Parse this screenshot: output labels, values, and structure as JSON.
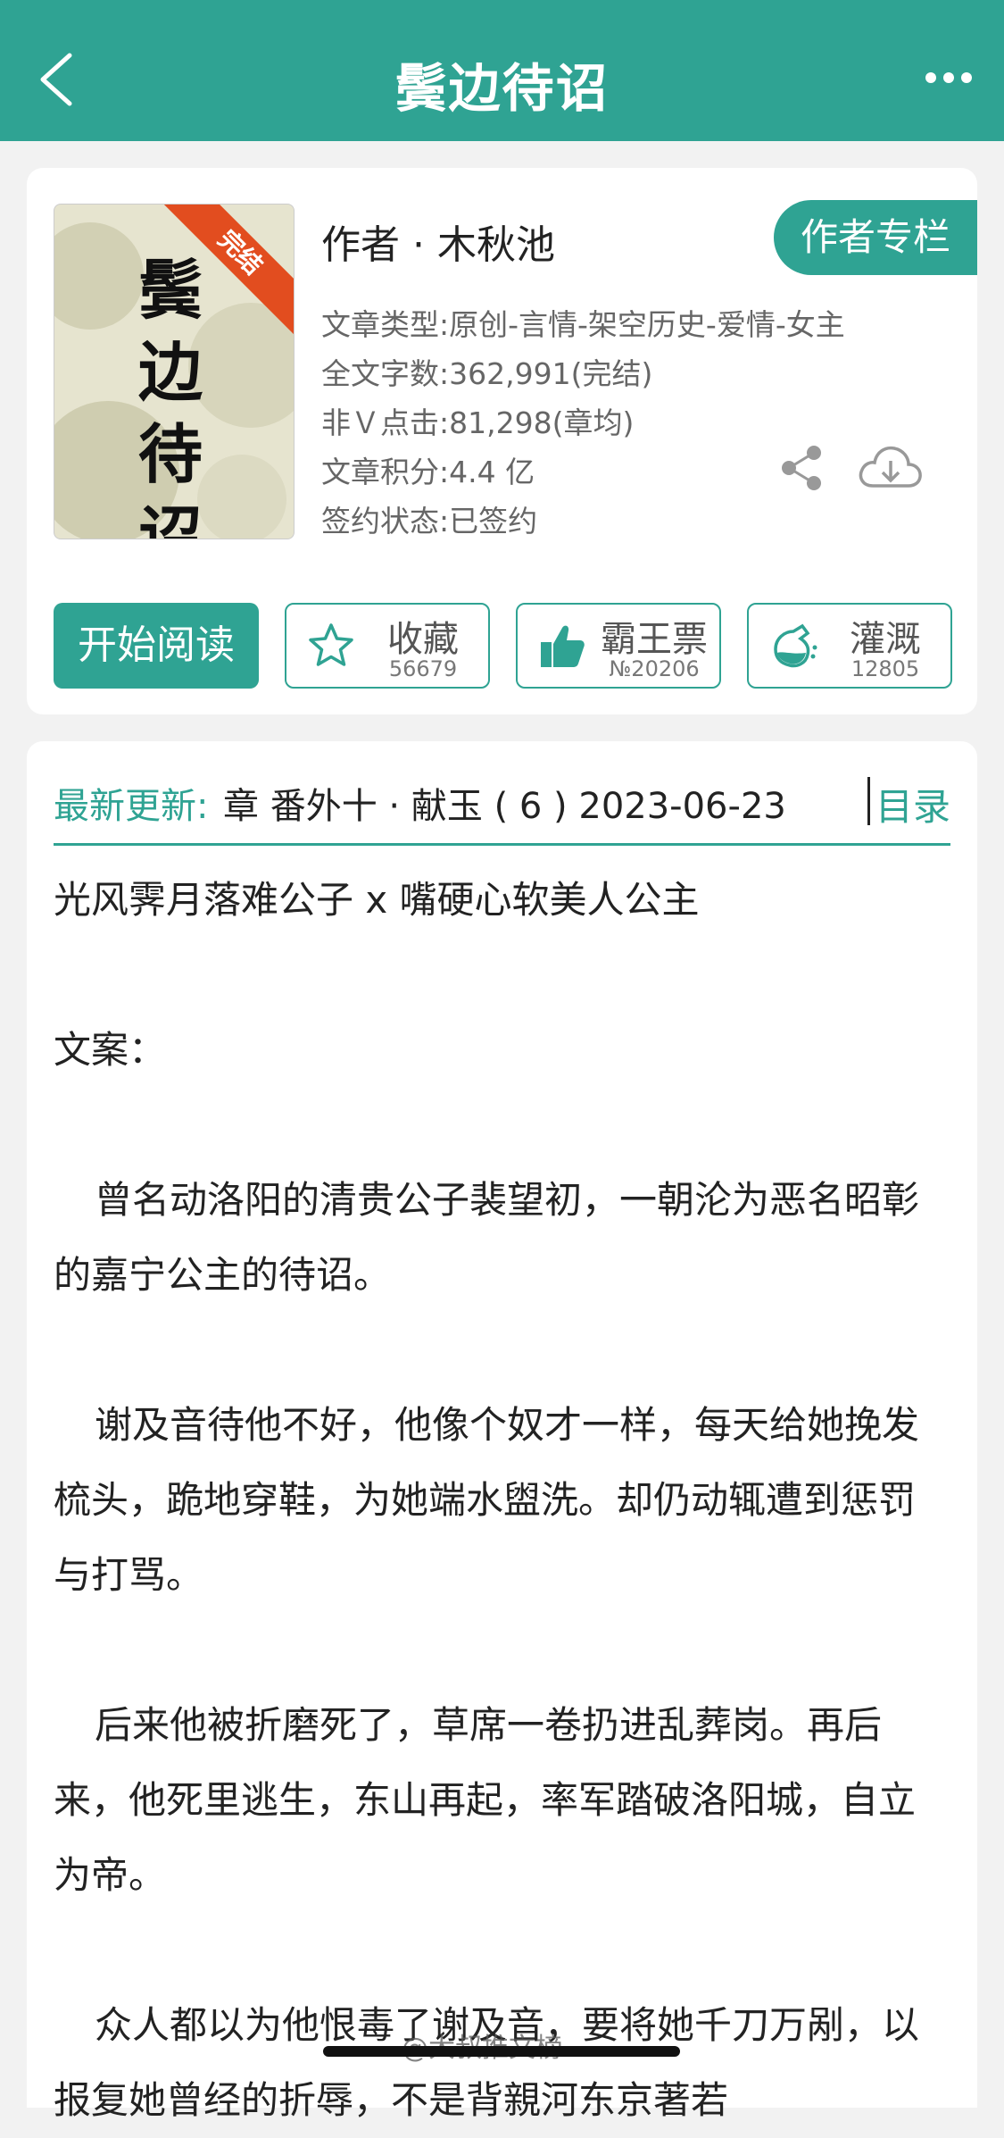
{
  "header": {
    "title": "鬓边待诏",
    "back_icon": "chevron-left-icon",
    "more_icon": "more-dots-icon"
  },
  "book": {
    "cover_title": "鬓边待诏",
    "cover_badge": "完结",
    "author": "作者 · 木秋池",
    "author_column_label": "作者专栏",
    "meta": {
      "type": "文章类型:原创-言情-架空历史-爱情-女主",
      "word_count": "全文字数:362,991(完结)",
      "clicks": "非Ｖ点击:81,298(章均)",
      "score": "文章积分:4.4 亿",
      "contract": "签约状态:已签约"
    }
  },
  "actions": {
    "start_reading": "开始阅读",
    "favorite": {
      "label": "收藏",
      "count": "56679"
    },
    "bawangpiao": {
      "label": "霸王票",
      "count": "№20206"
    },
    "irrigate": {
      "label": "灌溉",
      "count": "12805"
    }
  },
  "update": {
    "label": "最新更新:",
    "text": "章 番外十 · 献玉 ( 6 ) 2023-06-23",
    "catalog_label": "目录"
  },
  "intro": {
    "tagline": "光风霁月落难公子 x 嘴硬心软美人公主",
    "heading": "文案：",
    "para1": "曾名动洛阳的清贵公子裴望初，一朝沦为恶名昭彰的嘉宁公主的待诏。",
    "para2": "谢及音待他不好，他像个奴才一样，每天给她挽发梳头，跪地穿鞋，为她端水盥洗。却仍动辄遭到惩罚与打骂。",
    "para3": "后来他被折磨死了，草席一卷扔进乱葬岗。再后来，他死里逃生，东山再起，率军踏破洛阳城，自立为帝。",
    "para4": "众人都以为他恨毒了谢及音，要将她千刀万剐，以报复她曾经的折辱，不是背親河东京著若"
  },
  "watermark": "@大叔推文榜",
  "colors": {
    "brand": "#2fa393",
    "badge": "#e24d1f"
  }
}
